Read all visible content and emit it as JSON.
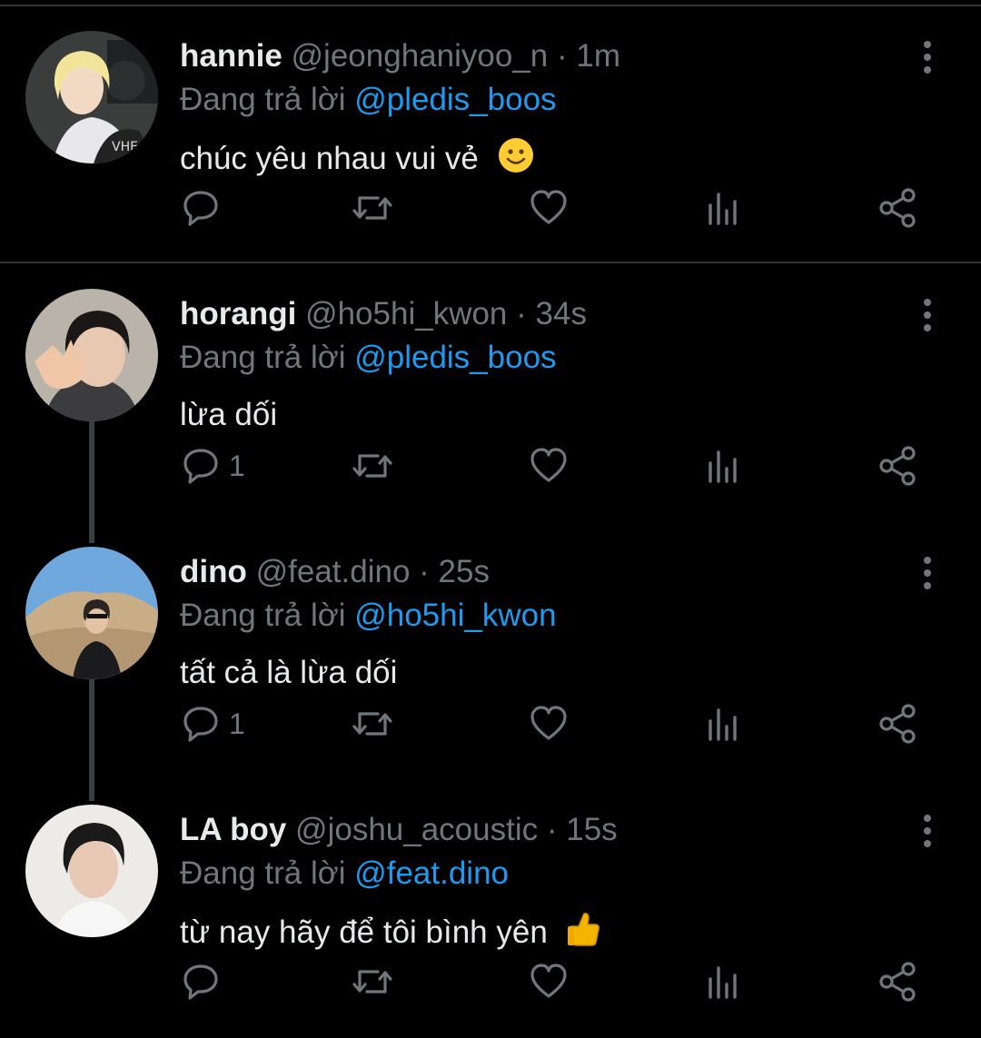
{
  "tweets": [
    {
      "name": "hannie",
      "handle": "@jeonghaniyoo_n",
      "time": "1m",
      "reply_prefix": "Đang trả lời",
      "reply_to": "@pledis_boos",
      "text": "chúc yêu nhau vui vẻ",
      "emoji": "smiling-face-icon",
      "reply_count": ""
    },
    {
      "name": "horangi",
      "handle": "@ho5hi_kwon",
      "time": "34s",
      "reply_prefix": "Đang trả lời",
      "reply_to": "@pledis_boos",
      "text": "lừa dối",
      "emoji": "",
      "reply_count": "1"
    },
    {
      "name": "dino",
      "handle": "@feat.dino",
      "time": "25s",
      "reply_prefix": "Đang trả lời",
      "reply_to": "@ho5hi_kwon",
      "text": "tất cả là lừa dối",
      "emoji": "",
      "reply_count": "1"
    },
    {
      "name": "LA boy",
      "handle": "@joshu_acoustic",
      "time": "15s",
      "reply_prefix": "Đang trả lời",
      "reply_to": "@feat.dino",
      "text": "từ nay hãy để tôi bình yên",
      "emoji": "thumbs-up-icon",
      "reply_count": ""
    }
  ],
  "separator": "·",
  "colors": {
    "background": "#000000",
    "primary_text": "#e7e9ea",
    "secondary_text": "#71767b",
    "mention": "#1d9bf0",
    "divider": "#2f3336"
  }
}
